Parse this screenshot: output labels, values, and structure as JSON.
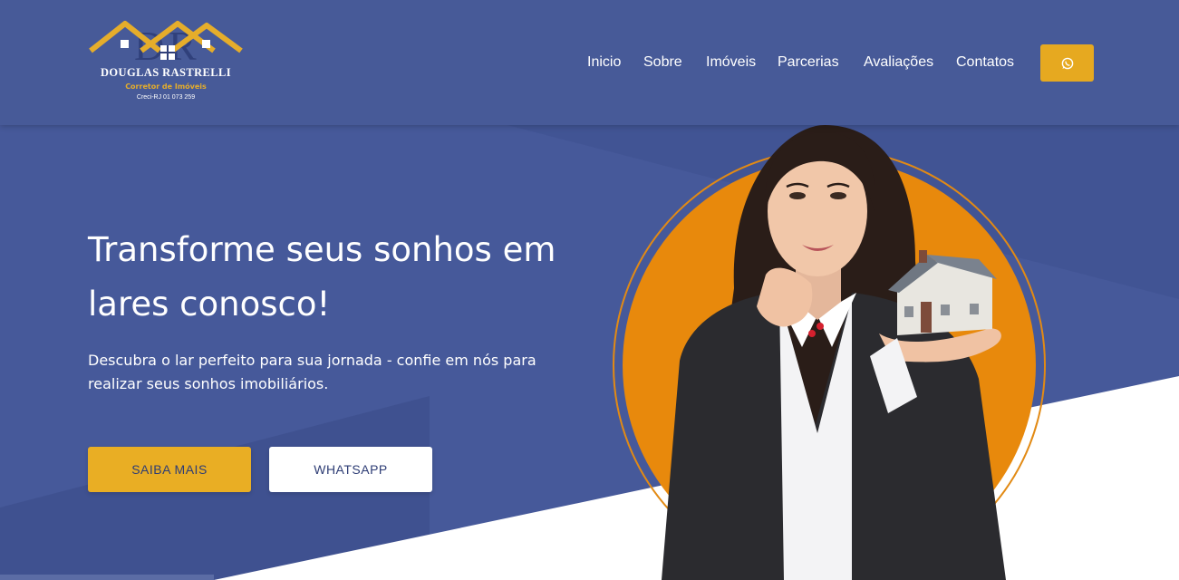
{
  "brand": {
    "name": "DOUGLAS RASTRELLI",
    "subtitle": "Corretor de Imóveis",
    "creci": "Creci-RJ 01 073 259",
    "monogram": "DR"
  },
  "nav": {
    "items": [
      "Inicio",
      "Sobre",
      "Imóveis",
      "Parcerias",
      "Avaliações",
      "Contatos"
    ],
    "whatsapp_icon": "whatsapp-icon"
  },
  "hero": {
    "title_line1": "Transforme seus sonhos em",
    "title_line2": "lares conosco!",
    "subtitle_line1": "Descubra o lar perfeito para sua jornada - confie em nós para",
    "subtitle_line2": "realizar seus sonhos imobiliários.",
    "primary_button": "SAIBA MAIS",
    "secondary_button": "WHATSAPP"
  },
  "colors": {
    "header": "#475a98",
    "background": "#46599a",
    "accent": "#e9ae24",
    "circle": "#e8890c",
    "white": "#ffffff"
  }
}
